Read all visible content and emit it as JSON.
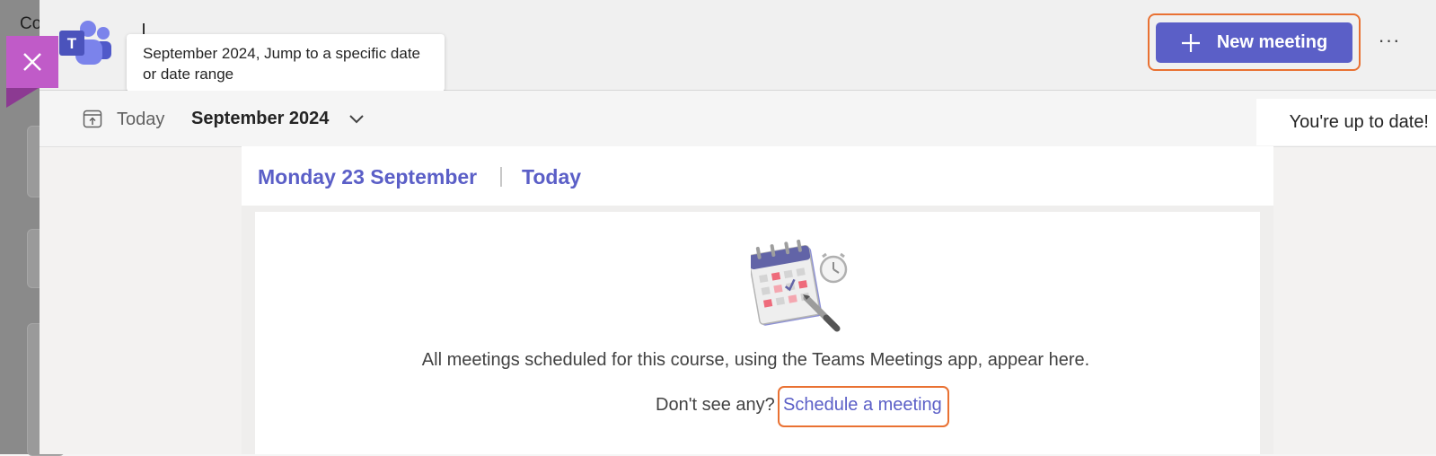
{
  "background": {
    "left_text": "Co"
  },
  "header": {
    "tooltip_text": "September 2024, Jump to a specific date or date range",
    "new_meeting_label": "New meeting",
    "more_label": "···"
  },
  "toolbar": {
    "today_label": "Today",
    "month_label": "September 2024",
    "status_text": "You're up to date!"
  },
  "day": {
    "date_label": "Monday 23 September",
    "separator": "|",
    "today_label": "Today"
  },
  "empty_state": {
    "message": "All meetings scheduled for this course, using the Teams Meetings app, appear here.",
    "prompt": "Don't see any?",
    "link_label": "Schedule a meeting"
  },
  "colors": {
    "accent": "#5b5fc7",
    "highlight": "#e97132",
    "close_tile": "#c05bc8"
  },
  "icons": [
    "teams-logo-icon",
    "close-icon",
    "plus-icon",
    "more-icon",
    "today-calendar-icon",
    "chevron-down-icon",
    "calendar-illustration-icon"
  ]
}
